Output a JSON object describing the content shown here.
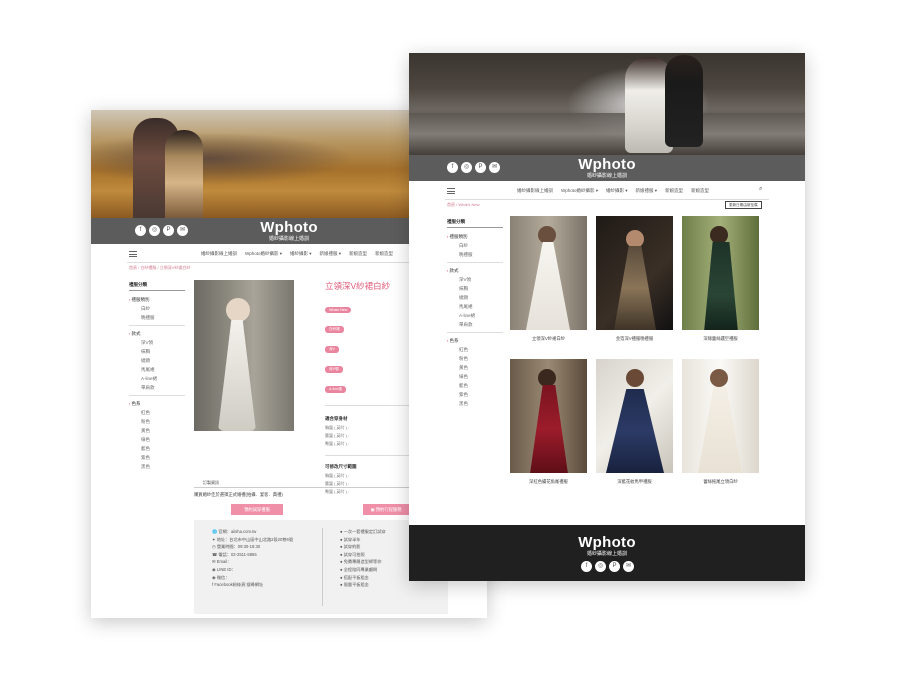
{
  "brand": {
    "logo": "Wphoto",
    "slogan": "婚紗攝影線上婚訓",
    "social_icons": [
      "facebook-icon",
      "instagram-icon",
      "pinterest-icon",
      "mail-icon"
    ],
    "accent": "#e9859e",
    "bar_color": "#5c5c5c"
  },
  "page_a": {
    "nav": [
      "婚紗攝影線上婚訓",
      "Wphoto婚紗攝影 ▾",
      "婚紗攝影 ▾",
      "新娘禮服 ▾",
      "新娘造型",
      "新娘造型"
    ],
    "breadcrumb": "首頁 / 白紗禮服 / 立領深V紗裙白紗",
    "sidebar": {
      "title": "禮服分類",
      "groups": [
        {
          "label": "禮服類別",
          "items": [
            "白紗",
            "晚禮服"
          ]
        },
        {
          "label": "款式",
          "items": [
            "深V領",
            "抹胸",
            "繞頸",
            "馬尾裙",
            "A-line裙",
            "單肩款"
          ]
        },
        {
          "label": "色系",
          "items": [
            "紅色",
            "粉色",
            "黃色",
            "綠色",
            "藍色",
            "紫色",
            "黑色"
          ]
        }
      ]
    },
    "product": {
      "title": "立領深V紗裙白紗",
      "tags": [
        "Whats New",
        "白紗禮",
        "深V",
        "深V領",
        "A-line裙"
      ],
      "size_heading": "適合穿身材",
      "size_lines": [
        "胸圍 ( 英吋 ) :",
        "腰圍 ( 英吋 ) :",
        "臀圍 ( 英吋 ) :"
      ],
      "alter_heading": "可修改尺寸範圍",
      "alter_lines": [
        "胸圍 ( 英吋 ) :",
        "腰圍 ( 英吋 ) :",
        "臀圍 ( 英吋 ) :"
      ]
    },
    "tab_label": "訂製資訊",
    "note": "購買婚紗佳於選擇正式婚禮(拍攝．宴客．典禮)",
    "buttons": [
      "預約試穿禮服",
      "預約行程服務"
    ],
    "info_left": [
      "官網：aiisha.com.tw",
      "地址：台北市中山區中山北路2段20巷6號",
      "營業時間：09:30-18:30",
      "電話：02-2511-5855",
      "Email：",
      "LINE ID：",
      "微信：",
      "Facebook粉絲頁:搜尋網址"
    ],
    "info_right": [
      "一次一套禮服定訂試穿",
      "試穿半年",
      "試穿約影",
      "試穿可拍照",
      "免費專屬造型師等你",
      "全程陪同專業顧問",
      "搭配平板租金",
      "限量平板租金"
    ]
  },
  "page_b": {
    "nav": [
      "婚紗攝影線上婚訓",
      "Wphoto婚紗攝影 ▾",
      "婚紗攝影 ▾",
      "新娘禮服 ▾",
      "新娘造型",
      "新娘造型"
    ],
    "breadcrumb": "首頁 / What's New",
    "sort_label": "更新日期由新至舊",
    "sidebar": {
      "title": "禮服分類",
      "groups": [
        {
          "label": "禮服類別",
          "items": [
            "白紗",
            "晚禮服"
          ]
        },
        {
          "label": "款式",
          "items": [
            "深V領",
            "抹胸",
            "繞頸",
            "馬尾裙",
            "A-line裙",
            "單肩款"
          ]
        },
        {
          "label": "色系",
          "items": [
            "紅色",
            "粉色",
            "黃色",
            "綠色",
            "藍色",
            "紫色",
            "黑色"
          ]
        }
      ]
    },
    "products": [
      {
        "name": "立領深V紗裙白紗"
      },
      {
        "name": "金箔深V禮服晚禮服"
      },
      {
        "name": "深綠蕾絲鏤空禮服"
      },
      {
        "name": "深紅色繡花魚尾禮服"
      },
      {
        "name": "深藍花紋馬甲禮服"
      },
      {
        "name": "蕾絲拖尾立領白紗"
      }
    ]
  }
}
